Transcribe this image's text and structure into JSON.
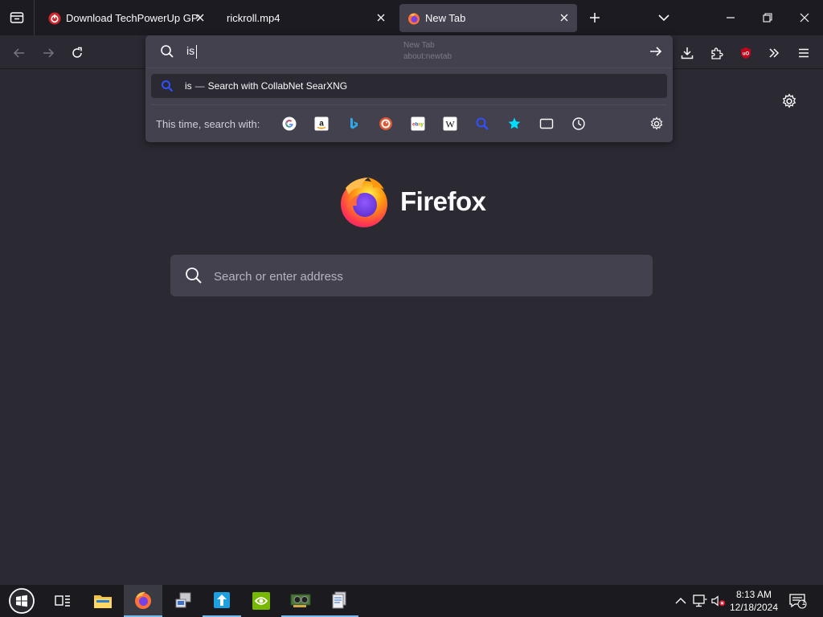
{
  "tabs": [
    {
      "title": "Download TechPowerUp GPU-Z",
      "favicon": "gpuz-favicon"
    },
    {
      "title": "rickroll.mp4",
      "favicon": ""
    },
    {
      "title": "New Tab",
      "favicon": "firefox-favicon"
    }
  ],
  "urlbar": {
    "typed": "is",
    "ghost_title": "New Tab",
    "ghost_url": "about:newtab"
  },
  "suggestion": {
    "query": "is",
    "dash": "—",
    "action": "Search with CollabNet SearXNG"
  },
  "oneoff": {
    "label": "This time, search with:",
    "engines": [
      "Google",
      "Amazon",
      "Bing",
      "DuckDuckGo",
      "eBay",
      "Wikipedia",
      "SearXNG",
      "Bookmarks",
      "Tabs",
      "History"
    ]
  },
  "newtab": {
    "brand": "Firefox",
    "search_placeholder": "Search or enter address"
  },
  "taskbar": {
    "time": "8:13 AM",
    "date": "12/18/2024",
    "notification_count": "1"
  },
  "colors": {
    "background": "#2b2a33",
    "toolbar": "#1c1b22",
    "popup": "#42414d",
    "accent": "#76b9ed"
  }
}
